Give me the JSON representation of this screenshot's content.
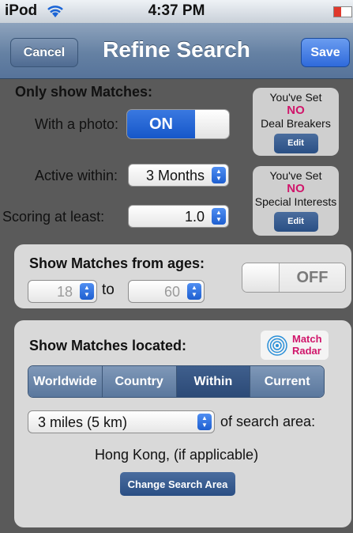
{
  "status": {
    "carrier": "iPod",
    "time": "4:37 PM"
  },
  "nav": {
    "cancel": "Cancel",
    "title": "Refine Search",
    "save": "Save"
  },
  "only_show": {
    "heading": "Only show Matches:",
    "with_photo_label": "With a photo:",
    "photo_toggle": "ON",
    "active_label": "Active within:",
    "active_value": "3 Months",
    "scoring_label": "Scoring at least:",
    "scoring_value": "1.0"
  },
  "deal_breakers": {
    "line1": "You've Set",
    "no": "NO",
    "line2": "Deal Breakers",
    "edit": "Edit"
  },
  "special_interests": {
    "line1": "You've Set",
    "no": "NO",
    "line2": "Special Interests",
    "edit": "Edit"
  },
  "ages": {
    "heading": "Show Matches from ages:",
    "min": "18",
    "to": "to",
    "max": "60",
    "toggle": "OFF"
  },
  "location": {
    "heading": "Show Matches located:",
    "radar": [
      "Match",
      "Radar"
    ],
    "segments": [
      "Worldwide",
      "Country",
      "Within",
      "Current"
    ],
    "active_segment": "Within",
    "distance_value": "3 miles (5 km)",
    "distance_suffix": "of search area:",
    "area_text": "Hong Kong, (if applicable)",
    "change_button": "Change Search Area"
  },
  "colors": {
    "accent_blue": "#1657c9",
    "highlight_pink": "#d0166b"
  }
}
